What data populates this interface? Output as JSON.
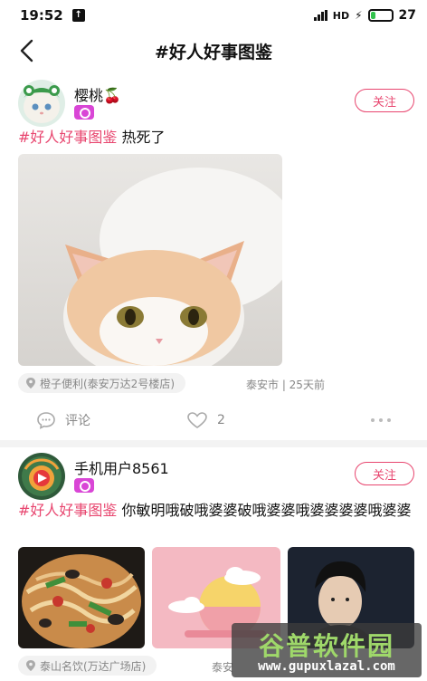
{
  "status_bar": {
    "time": "19:52",
    "battery": "27",
    "battery_level": 0.27,
    "colors": {
      "battery_fill": "#33c24d"
    }
  },
  "header": {
    "title": "#好人好事图鉴",
    "back_icon": "chevron-left-icon"
  },
  "posts": [
    {
      "username": "樱桃🍒",
      "follow_label": "关注",
      "tag": "#好人好事图鉴",
      "text": " 热死了",
      "location": "橙子便利(泰安万达2号楼店)",
      "meta": "泰安市 | 25天前",
      "comment_label": "评论",
      "like_count": "2",
      "image": "white-orange-kitten"
    },
    {
      "username": "手机用户8561",
      "follow_label": "关注",
      "tag": "#好人好事图鉴",
      "text": " 你敏明哦破哦婆婆破哦婆婆哦婆婆婆婆哦婆婆",
      "location": "泰山名饮(万达广场店)",
      "meta": "泰安",
      "images": [
        "stir-fried-noodles",
        "pink-moon-cloud",
        "young-man-portrait"
      ]
    }
  ],
  "watermark": {
    "title": "谷普软件园",
    "url": "www.gupuxlazal.com"
  },
  "colors": {
    "accent": "#e8466f",
    "badge": "#d946d6",
    "muted": "#888888"
  }
}
